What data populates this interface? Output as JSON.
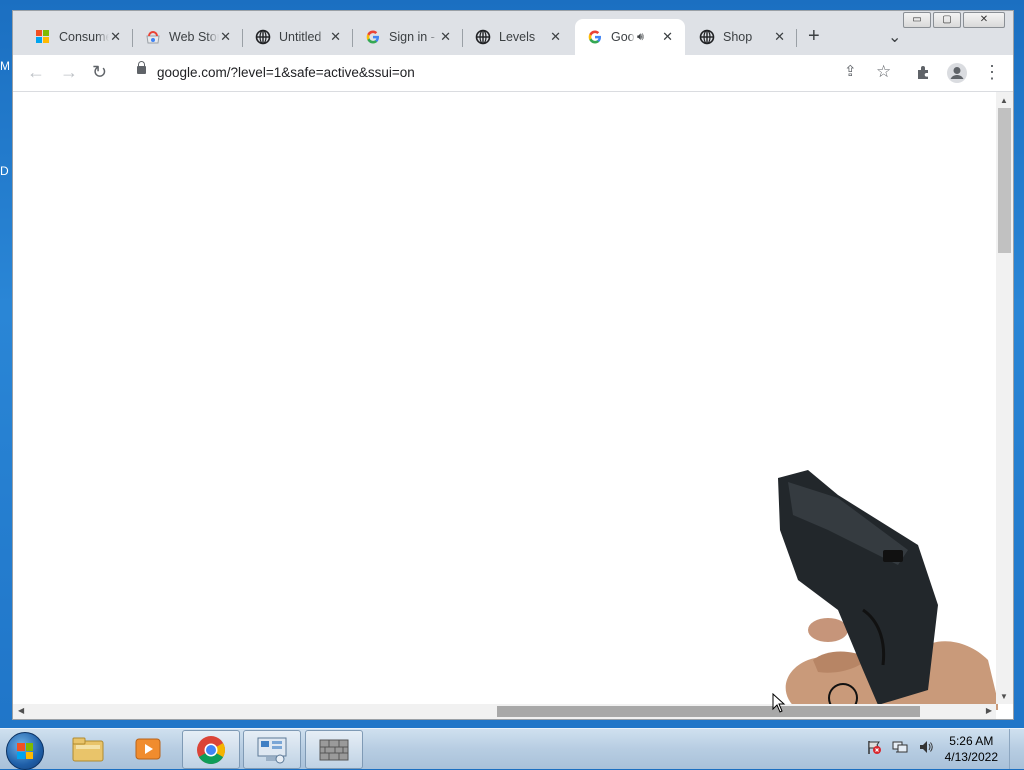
{
  "desktop": {
    "left_labels": [
      "M",
      "D"
    ]
  },
  "browser": {
    "tabs": [
      {
        "title": "Consumer",
        "icon": "microsoft-icon"
      },
      {
        "title": "Web Store",
        "icon": "webstore-icon"
      },
      {
        "title": "Untitled",
        "icon": "globe-icon"
      },
      {
        "title": "Sign in -",
        "icon": "google-icon"
      },
      {
        "title": "Levels",
        "icon": "globe-icon"
      },
      {
        "title": "Goo",
        "icon": "google-icon",
        "active": true,
        "audio": "speaker-icon"
      },
      {
        "title": "Shop",
        "icon": "globe-icon"
      }
    ],
    "new_tab_label": "+",
    "tab_search_label": "⌄",
    "window_controls": {
      "minimize": "▭",
      "maximize": "▢",
      "close": "✕"
    },
    "toolbar": {
      "back": "←",
      "forward": "→",
      "reload": "↻",
      "url": "google.com/?level=1&safe=active&ssui=on",
      "share": "⇪",
      "bookmark": "☆",
      "extensions": "extensions-icon",
      "profile": "profile-icon",
      "menu": "⋮"
    },
    "scrollbars": {
      "up": "▲",
      "down": "▼",
      "left": "◀",
      "right": "▶"
    }
  },
  "taskbar": {
    "items": [
      "explorer-icon",
      "media-player-icon",
      "chrome-icon",
      "control-panel-icon",
      "firewall-icon"
    ],
    "tray": [
      "action-center-icon",
      "network-icon",
      "volume-icon"
    ],
    "time": "5:26 AM",
    "date": "4/13/2022"
  },
  "colors": {
    "accent": "#1a73e8",
    "taskbar": "#b7cde2",
    "desktop": "#1f74c7"
  }
}
